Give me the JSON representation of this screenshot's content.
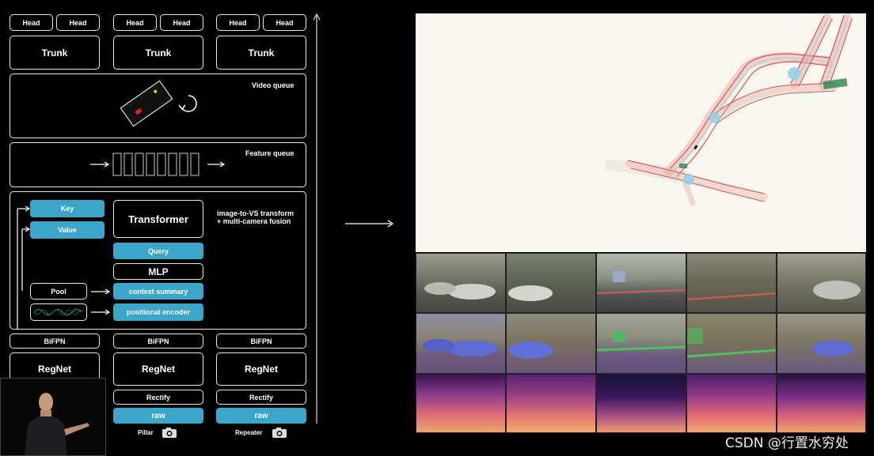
{
  "left_diagram": {
    "head_label": "Head",
    "trunk_label": "Trunk",
    "video_queue": "Video queue",
    "feature_queue": "Feature queue",
    "transformer": "Transformer",
    "transform_note_line1": "image-to-VS transform",
    "transform_note_line2": "+ multi-camera fusion",
    "key": "Key",
    "value": "Value",
    "query": "Query",
    "mlp": "MLP",
    "pool": "Pool",
    "context_summary": "context summary",
    "positional_encoder": "positional encoder",
    "bifpn": "BiFPN",
    "regnet": "RegNet",
    "rectify": "Rectify",
    "raw": "raw",
    "pillar": "Pillar",
    "repeater": "Repeater"
  },
  "watermark": {
    "text": "CSDN @行置水穷处"
  },
  "colors": {
    "accent_blue": "#3ba6c9",
    "background": "#000000",
    "road_red": "#e0605a",
    "road_blue": "#7bc7e6"
  }
}
